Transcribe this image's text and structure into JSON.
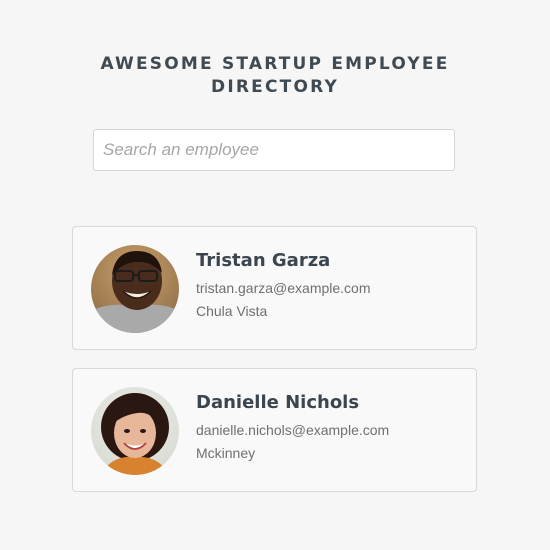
{
  "header": {
    "title_line1": "AWESOME STARTUP EMPLOYEE",
    "title_line2": "DIRECTORY"
  },
  "search": {
    "placeholder": "Search an employee",
    "value": ""
  },
  "employees": [
    {
      "name": "Tristan Garza",
      "email": "tristan.garza@example.com",
      "city": "Chula Vista"
    },
    {
      "name": "Danielle Nichols",
      "email": "danielle.nichols@example.com",
      "city": "Mckinney"
    }
  ],
  "colors": {
    "background": "#f6f6f6",
    "title": "#3f4a52",
    "card_border": "#d8d8d8",
    "secondary_text": "#6f6f6f"
  }
}
